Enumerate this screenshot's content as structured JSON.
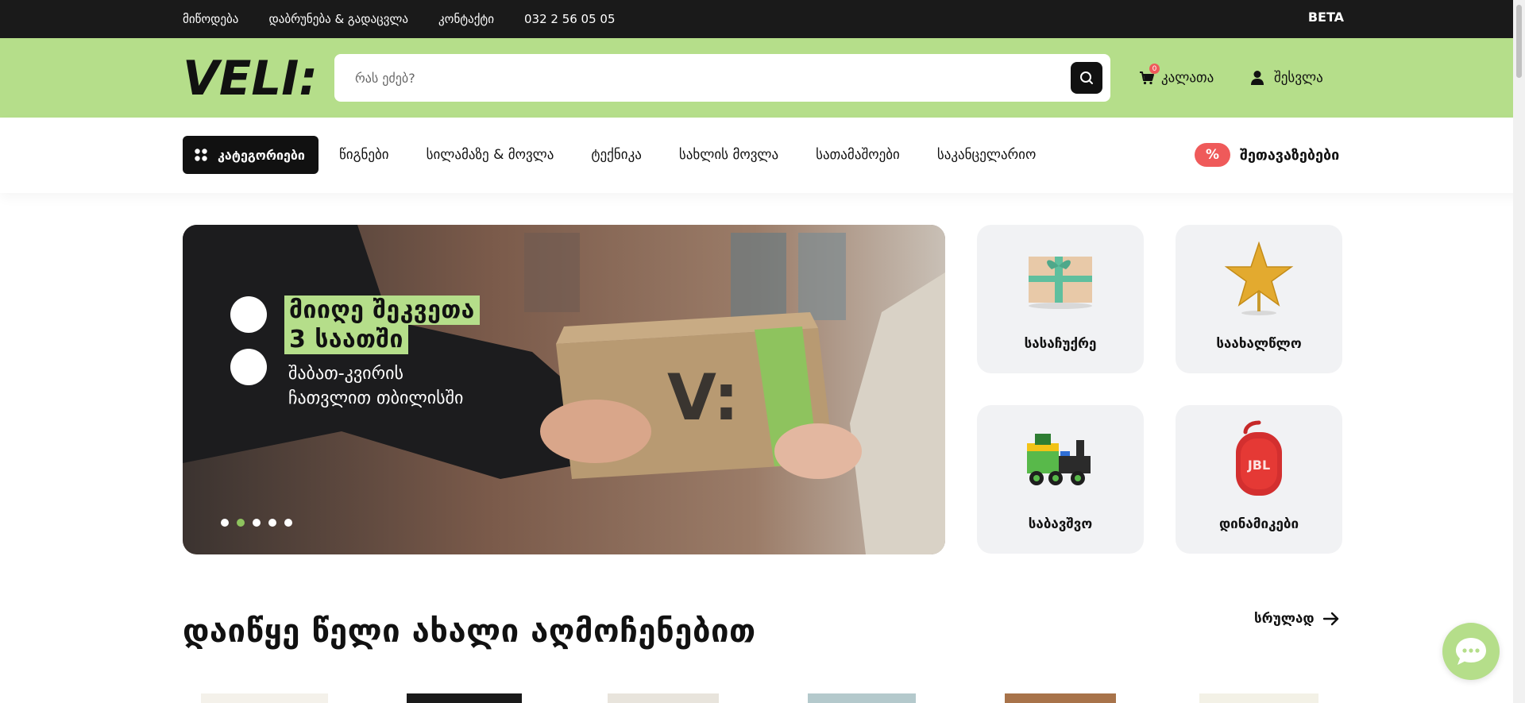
{
  "topbar": {
    "links": [
      "მიწოდება",
      "დაბრუნება & გადაცვლა",
      "კონტაქტი",
      "032 2 56 05 05"
    ],
    "beta": "BETA"
  },
  "header": {
    "logo_text": "VELI:",
    "search_placeholder": "რას ეძებ?",
    "cart_label": "კალათა",
    "cart_count": "0",
    "login_label": "შესვლა",
    "accent_color": "#b5de8a"
  },
  "nav": {
    "categories_label": "კატეგორიები",
    "links": [
      "წიგნები",
      "სილამაზე & მოვლა",
      "ტექნიკა",
      "სახლის მოვლა",
      "სათამაშოები",
      "საკანცელარიო"
    ],
    "deals_icon": "%",
    "deals_label": "შეთავაზებები"
  },
  "hero": {
    "headline_line1": "მიიღე შეკვეთა",
    "headline_line2": "3 საათში",
    "sub_line1": "შაბათ-კვირის",
    "sub_line2": "ჩათვლით თბილისში",
    "slide_count": 5,
    "active_slide": 2
  },
  "tiles": [
    {
      "label": "სასაჩუქრე",
      "icon": "gift-box-icon"
    },
    {
      "label": "საახალწლო",
      "icon": "star-icon"
    },
    {
      "label": "საბავშვო",
      "icon": "toy-train-icon"
    },
    {
      "label": "დინამიკები",
      "icon": "speaker-icon"
    }
  ],
  "section": {
    "title": "დაიწყე წელი ახალი აღმოჩენებით",
    "see_all": "სრულად"
  }
}
